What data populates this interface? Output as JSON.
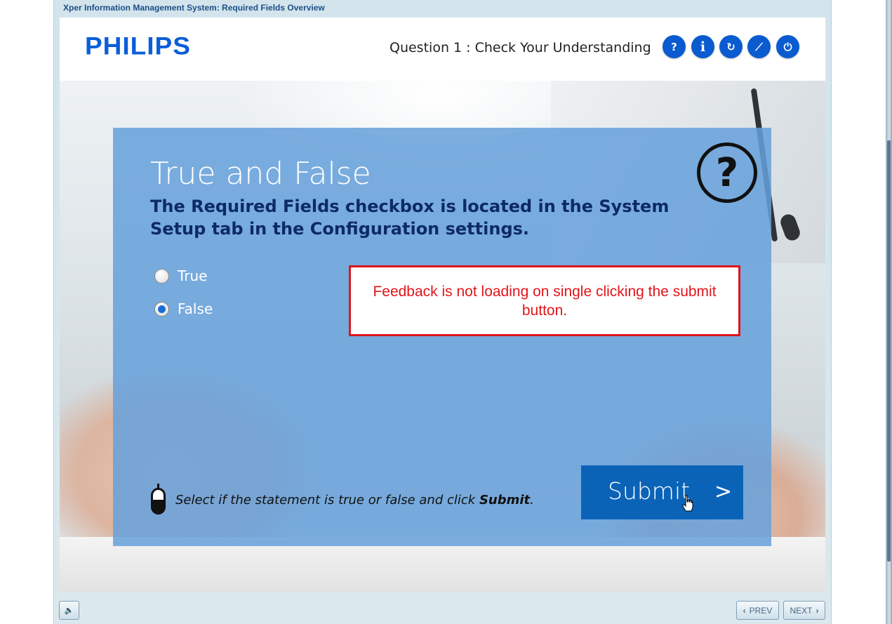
{
  "window": {
    "title": "Xper Information Management System: Required Fields Overview"
  },
  "header": {
    "logo": "PHILIPS",
    "question_title": "Question 1 : Check Your Understanding",
    "buttons": [
      {
        "icon": "help-icon",
        "glyph": "?"
      },
      {
        "icon": "info-icon",
        "glyph": "i"
      },
      {
        "icon": "replay-icon",
        "glyph": "↻"
      },
      {
        "icon": "compass-icon",
        "glyph": "⟋"
      },
      {
        "icon": "power-icon",
        "glyph": "⏻"
      }
    ]
  },
  "quiz": {
    "title": "True and False",
    "statement": "The Required Fields checkbox is located in the System Setup tab in the Configuration settings.",
    "options": [
      {
        "label": "True",
        "selected": false
      },
      {
        "label": "False",
        "selected": true
      }
    ],
    "feedback_note": "Feedback is not loading on single clicking the submit button.",
    "instruction_prefix": "Select if the statement is true or false and click ",
    "instruction_bold": "Submit",
    "instruction_suffix": ".",
    "submit_label": "Submit",
    "submit_arrow": ">"
  },
  "footer": {
    "volume_glyph": "🔈",
    "prev_label": "PREV",
    "next_label": "NEXT",
    "prev_glyph": "‹",
    "next_glyph": "›"
  },
  "colors": {
    "brand_blue": "#0b5ed7",
    "panel_blue": "#67a1db",
    "statement_navy": "#0d2a66",
    "submit_blue": "#0b63b8",
    "annotation_red": "#e0151b"
  }
}
